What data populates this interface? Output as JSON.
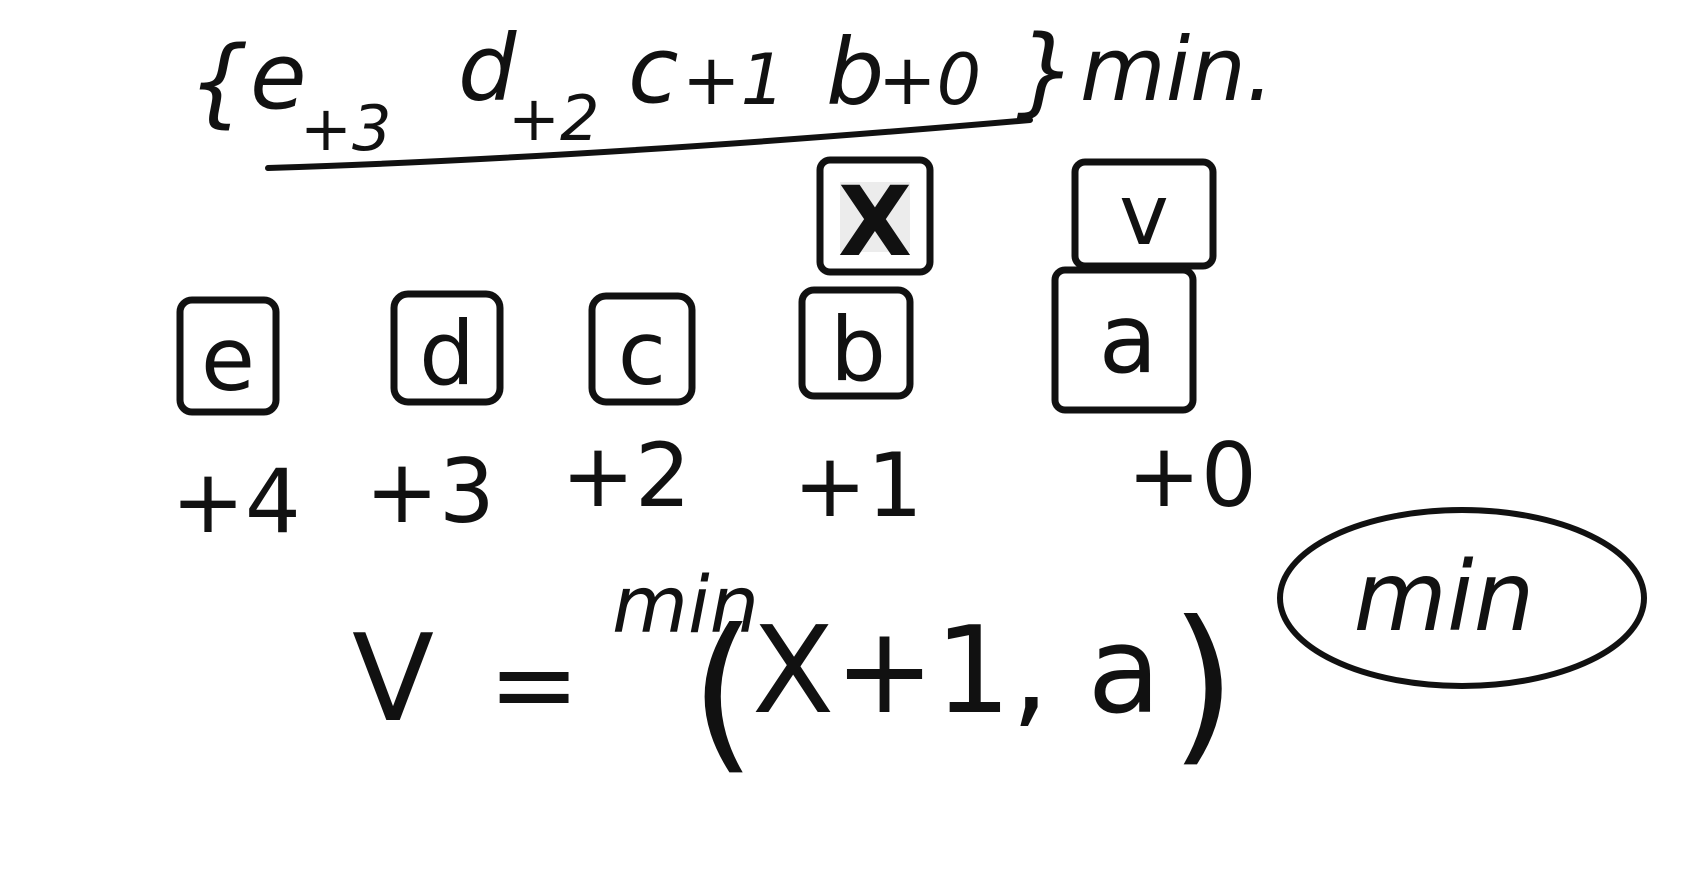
{
  "board": {
    "background": "#ffffff",
    "ink_color": "#111111"
  },
  "header": {
    "open_brace": "{",
    "items": [
      {
        "letter": "e",
        "sub": "+3"
      },
      {
        "letter": "d",
        "sub": "+2"
      },
      {
        "letter": "c",
        "sub": "+1"
      },
      {
        "letter": "b",
        "sub": "+0"
      }
    ],
    "close_brace": "}",
    "suffix": "min."
  },
  "top_boxes": [
    {
      "label": "X"
    },
    {
      "label": "v"
    }
  ],
  "bottom_boxes": [
    {
      "label": "e"
    },
    {
      "label": "d"
    },
    {
      "label": "c"
    },
    {
      "label": "b"
    },
    {
      "label": "a"
    }
  ],
  "offsets": [
    "+4",
    "+3",
    "+2",
    "+1",
    "+0"
  ],
  "formula": {
    "lhs": "V",
    "eq": "=",
    "func": "min",
    "open_paren": "(",
    "args": "X+1, a",
    "close_paren": ")"
  },
  "circled_note": "min"
}
